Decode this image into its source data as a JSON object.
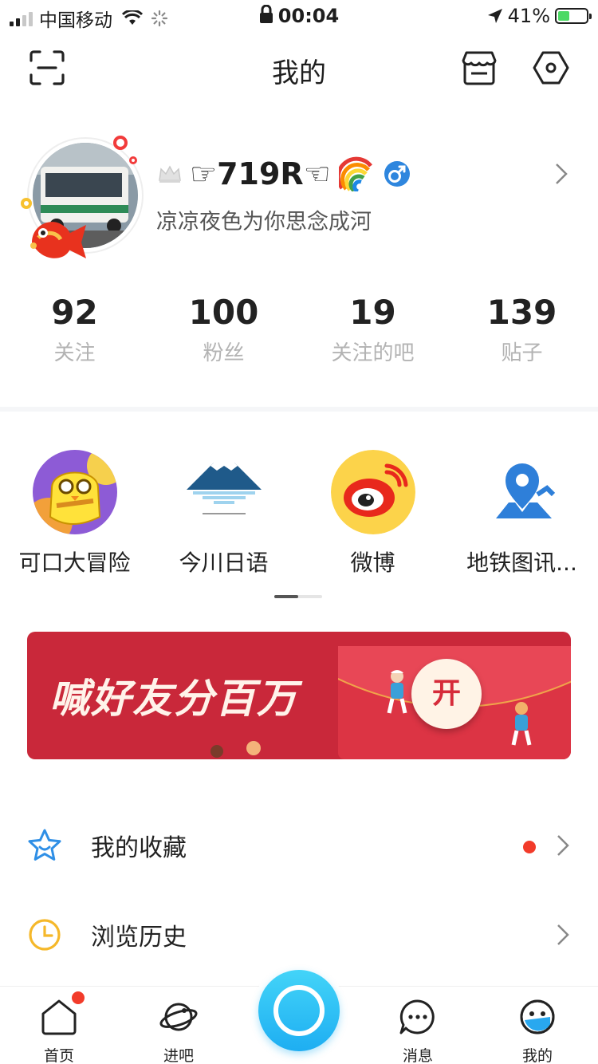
{
  "status_bar": {
    "carrier": "中国移动",
    "time": "00:04",
    "battery_percent": "41%",
    "battery_level": 0.41,
    "icons": [
      "signal-icon",
      "wifi-icon",
      "spinner-icon",
      "lock-icon",
      "location-arrow-icon",
      "battery-icon"
    ]
  },
  "nav": {
    "title": "我的",
    "left_icon": "scan-icon",
    "right_icons": [
      "store-icon",
      "settings-icon"
    ]
  },
  "profile": {
    "name": "☞719R☜",
    "bio": "凉凉夜色为你思念成河",
    "badges": [
      "crown-icon",
      "rainbow-icon",
      "male-icon"
    ]
  },
  "stats": [
    {
      "value": "92",
      "label": "关注"
    },
    {
      "value": "100",
      "label": "粉丝"
    },
    {
      "value": "19",
      "label": "关注的吧"
    },
    {
      "value": "139",
      "label": "贴子"
    }
  ],
  "apps": [
    {
      "label": "可口大冒险",
      "icon": "game-chick-icon"
    },
    {
      "label": "今川日语",
      "icon": "mount-fuji-icon"
    },
    {
      "label": "微博",
      "icon": "weibo-icon"
    },
    {
      "label": "地铁图讯...",
      "icon": "map-pin-icon"
    }
  ],
  "banner": {
    "title": "喊好友分百万",
    "button": "开"
  },
  "list": [
    {
      "label": "我的收藏",
      "icon": "star-icon",
      "has_dot": true
    },
    {
      "label": "浏览历史",
      "icon": "clock-icon",
      "has_dot": false
    }
  ],
  "tabs": [
    {
      "label": "首页",
      "icon": "home-icon",
      "badge": true
    },
    {
      "label": "进吧",
      "icon": "planet-icon",
      "badge": false
    },
    {
      "label": "消息",
      "icon": "message-icon",
      "badge": false
    },
    {
      "label": "我的",
      "icon": "profile-face-icon",
      "badge": false
    }
  ],
  "colors": {
    "accent_blue": "#1eaef2",
    "red": "#f23b2a",
    "banner_red": "#c9283a"
  }
}
